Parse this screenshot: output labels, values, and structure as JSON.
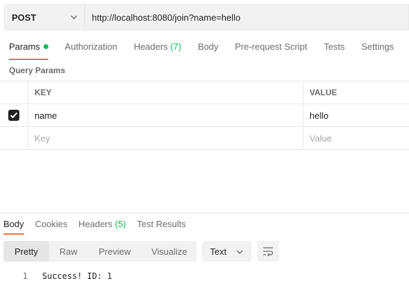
{
  "request": {
    "method": "POST",
    "url": "http://localhost:8080/join?name=hello"
  },
  "request_tabs": [
    {
      "label": "Params",
      "active": true,
      "dot": true
    },
    {
      "label": "Authorization"
    },
    {
      "label": "Headers",
      "count": "(7)"
    },
    {
      "label": "Body"
    },
    {
      "label": "Pre-request Script"
    },
    {
      "label": "Tests"
    },
    {
      "label": "Settings"
    }
  ],
  "query_params": {
    "section_label": "Query Params",
    "columns": {
      "key": "KEY",
      "value": "VALUE"
    },
    "rows": [
      {
        "checked": true,
        "key": "name",
        "value": "hello"
      }
    ],
    "placeholder": {
      "key": "Key",
      "value": "Value"
    }
  },
  "response_tabs": [
    {
      "label": "Body",
      "active": true
    },
    {
      "label": "Cookies"
    },
    {
      "label": "Headers",
      "count": "(5)"
    },
    {
      "label": "Test Results"
    }
  ],
  "view_modes": [
    "Pretty",
    "Raw",
    "Preview",
    "Visualize"
  ],
  "active_view": "Pretty",
  "format": "Text",
  "response_body": [
    {
      "line": "1",
      "text": "Success! ID: 1"
    }
  ],
  "colors": {
    "accent": "#ff6c37",
    "success": "#0cbb52",
    "panel": "#f2f2f2"
  }
}
